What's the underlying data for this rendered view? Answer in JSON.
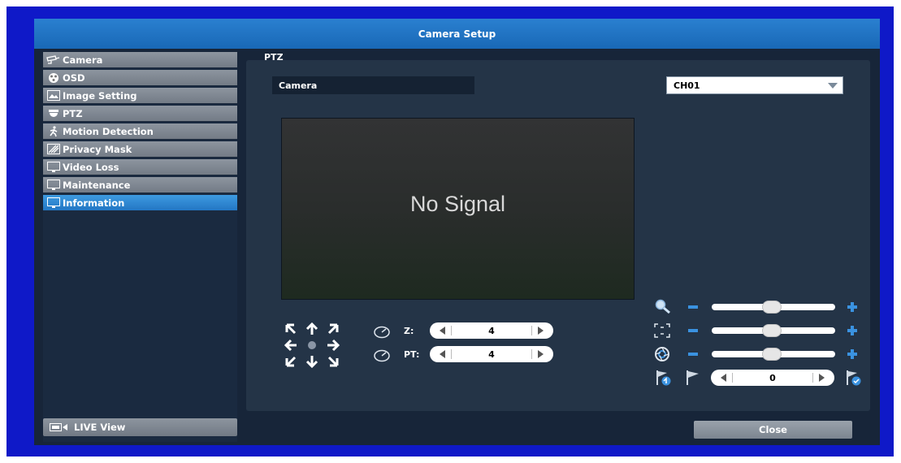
{
  "window": {
    "title": "Camera Setup"
  },
  "sidebar": {
    "items": [
      {
        "label": "Camera",
        "icon": "camera-icon"
      },
      {
        "label": "OSD",
        "icon": "osd-icon"
      },
      {
        "label": "Image Setting",
        "icon": "image-icon"
      },
      {
        "label": "PTZ",
        "icon": "ptz-icon"
      },
      {
        "label": "Motion Detection",
        "icon": "motion-icon"
      },
      {
        "label": "Privacy Mask",
        "icon": "privacy-mask-icon"
      },
      {
        "label": "Video Loss",
        "icon": "monitor-icon"
      },
      {
        "label": "Maintenance",
        "icon": "monitor-icon"
      },
      {
        "label": "Information",
        "icon": "monitor-icon"
      }
    ],
    "active": "Information",
    "live_view_label": "LIVE View"
  },
  "main": {
    "section_label": "PTZ",
    "camera_label": "Camera",
    "channel_select": {
      "value": "CH01"
    },
    "video": {
      "status_text": "No Signal"
    },
    "zoom_speed": {
      "label": "Z:",
      "value": "4"
    },
    "pan_tilt_speed": {
      "label": "PT:",
      "value": "4"
    },
    "preset": {
      "value": "0"
    }
  },
  "footer": {
    "close_label": "Close"
  },
  "colors": {
    "accent": "#2a80d0",
    "frame": "#0f19c8",
    "control_blue": "#3a92e0"
  }
}
